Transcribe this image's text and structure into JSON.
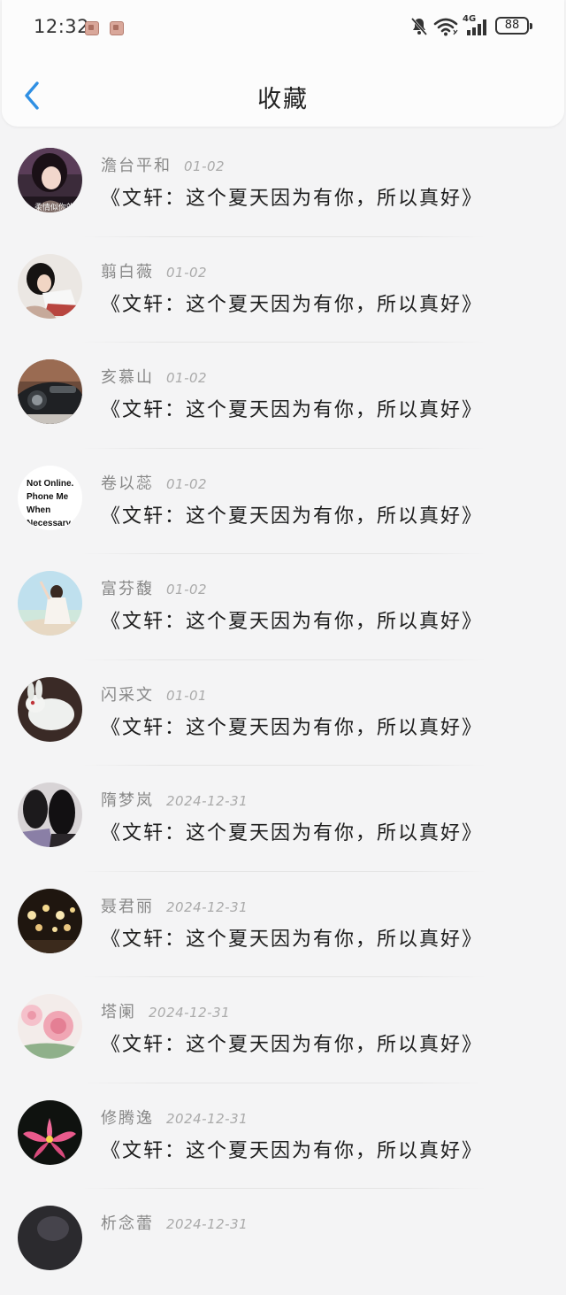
{
  "status_bar": {
    "time": "12:32",
    "network": "4G",
    "battery": "88"
  },
  "header": {
    "title": "收藏"
  },
  "colors": {
    "accent": "#2f8fe3",
    "name_text": "#888888",
    "date_text": "#aaaaaa",
    "title_text": "#1c1c1c"
  },
  "items": [
    {
      "name": "澹台平和",
      "date": "01-02",
      "title": "《文轩：这个夏天因为有你，所以真好》",
      "avatar": "girl-dark-hair-photo",
      "avatar_caption": "柔情似你的"
    },
    {
      "name": "翦白薇",
      "date": "01-02",
      "title": "《文轩：这个夏天因为有你，所以真好》",
      "avatar": "girl-sitting-photo"
    },
    {
      "name": "亥慕山",
      "date": "01-02",
      "title": "《文轩：这个夏天因为有你，所以真好》",
      "avatar": "car-photo"
    },
    {
      "name": "卷以蕊",
      "date": "01-02",
      "title": "《文轩：这个夏天因为有你，所以真好》",
      "avatar": "text-avatar",
      "avatar_lines": [
        "Not Online.",
        "Phone Me",
        "When",
        "Necessary."
      ]
    },
    {
      "name": "富芬馥",
      "date": "01-02",
      "title": "《文轩：这个夏天因为有你，所以真好》",
      "avatar": "beach-girl-photo"
    },
    {
      "name": "闪采文",
      "date": "01-01",
      "title": "《文轩：这个夏天因为有你，所以真好》",
      "avatar": "jade-rabbit-photo"
    },
    {
      "name": "隋梦岚",
      "date": "2024-12-31",
      "title": "《文轩：这个夏天因为有你，所以真好》",
      "avatar": "girls-back-photo"
    },
    {
      "name": "聂君丽",
      "date": "2024-12-31",
      "title": "《文轩：这个夏天因为有你，所以真好》",
      "avatar": "lanterns-photo"
    },
    {
      "name": "塔阑",
      "date": "2024-12-31",
      "title": "《文轩：这个夏天因为有你，所以真好》",
      "avatar": "pink-roses-photo"
    },
    {
      "name": "修腾逸",
      "date": "2024-12-31",
      "title": "《文轩：这个夏天因为有你，所以真好》",
      "avatar": "pink-lotus-photo"
    },
    {
      "name": "析念蕾",
      "date": "2024-12-31",
      "title": "",
      "avatar": "dark-photo"
    }
  ]
}
